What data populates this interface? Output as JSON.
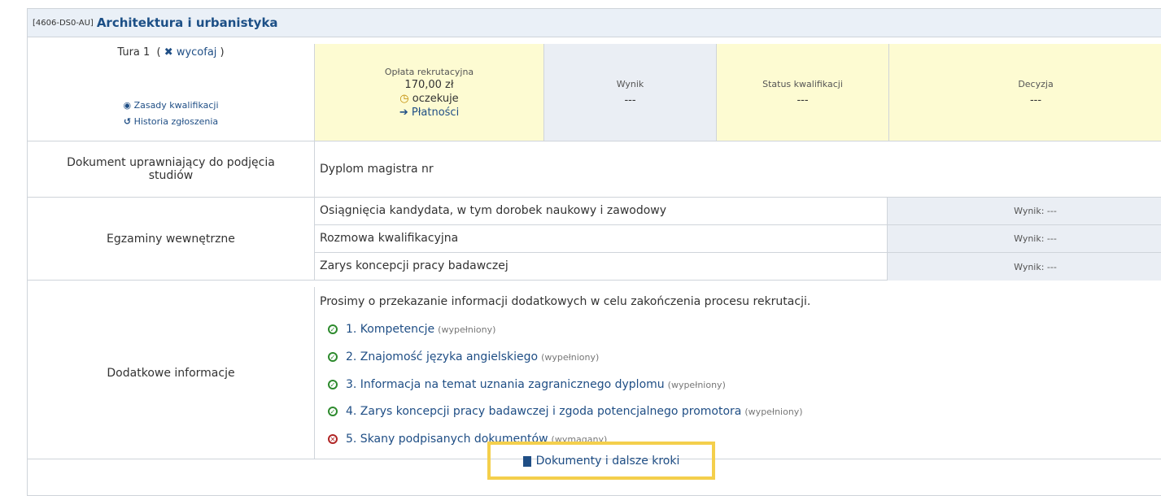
{
  "header": {
    "code": "[4606-DS0-AU]",
    "title": "Architektura i urbanistyka"
  },
  "round": {
    "label": "Tura 1",
    "open_paren": "(",
    "close_paren": ")",
    "withdraw_icon": "x-icon",
    "withdraw_label": "wycofaj",
    "rules_icon": "eye-icon",
    "rules_label": "Zasady kwalifikacji",
    "history_icon": "history-icon",
    "history_label": "Historia zgłoszenia"
  },
  "fee": {
    "label": "Opłata rekrutacyjna",
    "amount": "170,00 zł",
    "status_icon": "clock-icon",
    "status": "oczekuje",
    "payments_icon": "arrow-right-icon",
    "payments_label": "Płatności"
  },
  "result": {
    "label": "Wynik",
    "value": "---"
  },
  "qualification": {
    "label": "Status kwalifikacji",
    "value": "---"
  },
  "decision": {
    "label": "Decyzja",
    "value": "---"
  },
  "document": {
    "label": "Dokument uprawniający do podjęcia studiów",
    "value": "Dyplom magistra nr"
  },
  "exams": {
    "label": "Egzaminy wewnętrzne",
    "items": [
      {
        "name": "Osiągnięcia kandydata, w tym dorobek naukowy i zawodowy",
        "score": "Wynik: ---"
      },
      {
        "name": "Rozmowa kwalifikacyjna",
        "score": "Wynik: ---"
      },
      {
        "name": "Zarys koncepcji pracy badawczej",
        "score": "Wynik: ---"
      }
    ]
  },
  "additional": {
    "label": "Dodatkowe informacje",
    "intro": "Prosimy o przekazanie informacji dodatkowych w celu zakończenia procesu rekrutacji.",
    "items": [
      {
        "text": "1. Kompetencje",
        "state": "(wypełniony)",
        "icon": "check-circle-icon"
      },
      {
        "text": "2. Znajomość języka angielskiego",
        "state": "(wypełniony)",
        "icon": "check-circle-icon"
      },
      {
        "text": "3. Informacja na temat uznania zagranicznego dyplomu",
        "state": "(wypełniony)",
        "icon": "check-circle-icon"
      },
      {
        "text": "4. Zarys koncepcji pracy badawczej i zgoda potencjalnego promotora",
        "state": "(wypełniony)",
        "icon": "check-circle-icon"
      },
      {
        "text": "5. Skany podpisanych dokumentów",
        "state": "(wymagany)",
        "icon": "x-circle-icon"
      }
    ]
  },
  "next_steps": {
    "label": "Dokumenty i dalsze kroki",
    "icon": "document-icon"
  },
  "colors": {
    "accent": "#1f4e85",
    "highlight": "#f4cf4c",
    "fee_bg": "#fdfbd2",
    "gray_bg": "#eaeef4"
  }
}
